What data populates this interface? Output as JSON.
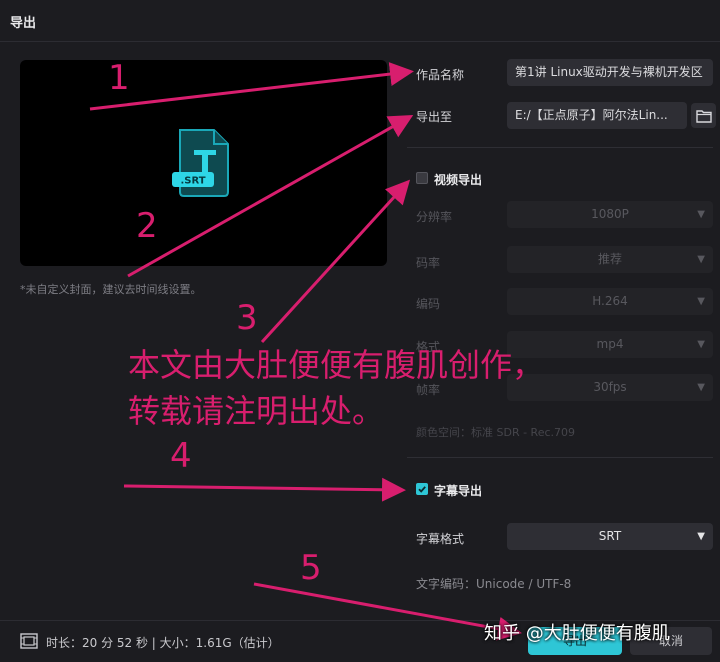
{
  "window": {
    "title": "导出"
  },
  "preview": {
    "badge": ".SRT",
    "cover_note": "*未自定义封面，建议去时间线设置。"
  },
  "form": {
    "name_label": "作品名称",
    "name_value": "第1讲 Linux驱动开发与裸机开发区",
    "export_to_label": "导出至",
    "export_to_value": "E:/【正点原子】阿尔法Lin..."
  },
  "video_export": {
    "label": "视频导出",
    "checked": false,
    "rows": [
      {
        "label": "分辨率",
        "value": "1080P"
      },
      {
        "label": "码率",
        "value": "推荐"
      },
      {
        "label": "编码",
        "value": "H.264"
      },
      {
        "label": "格式",
        "value": "mp4"
      },
      {
        "label": "帧率",
        "value": "30fps"
      }
    ],
    "info": "颜色空间：标准 SDR - Rec.709"
  },
  "subtitle_export": {
    "label": "字幕导出",
    "checked": true,
    "format_label": "字幕格式",
    "format_value": "SRT",
    "encoding_note": "文字编码：Unicode / UTF-8"
  },
  "footer": {
    "info": "时长：20 分 52 秒 | 大小：1.61G（估计）",
    "export_button": "导出",
    "cancel_button": "取消"
  },
  "annotations": {
    "numbers": [
      "1",
      "2",
      "3",
      "4",
      "5"
    ],
    "watermark_line1": "本文由大肚便便有腹肌创作，",
    "watermark_line2": "转载请注明出处。",
    "zhihu_mark": "知乎 @大肚便便有腹肌",
    "color": "#d81e6e"
  },
  "colors": {
    "accent": "#2ec6d6",
    "background": "#1c1c20",
    "field": "#2e2e34"
  }
}
